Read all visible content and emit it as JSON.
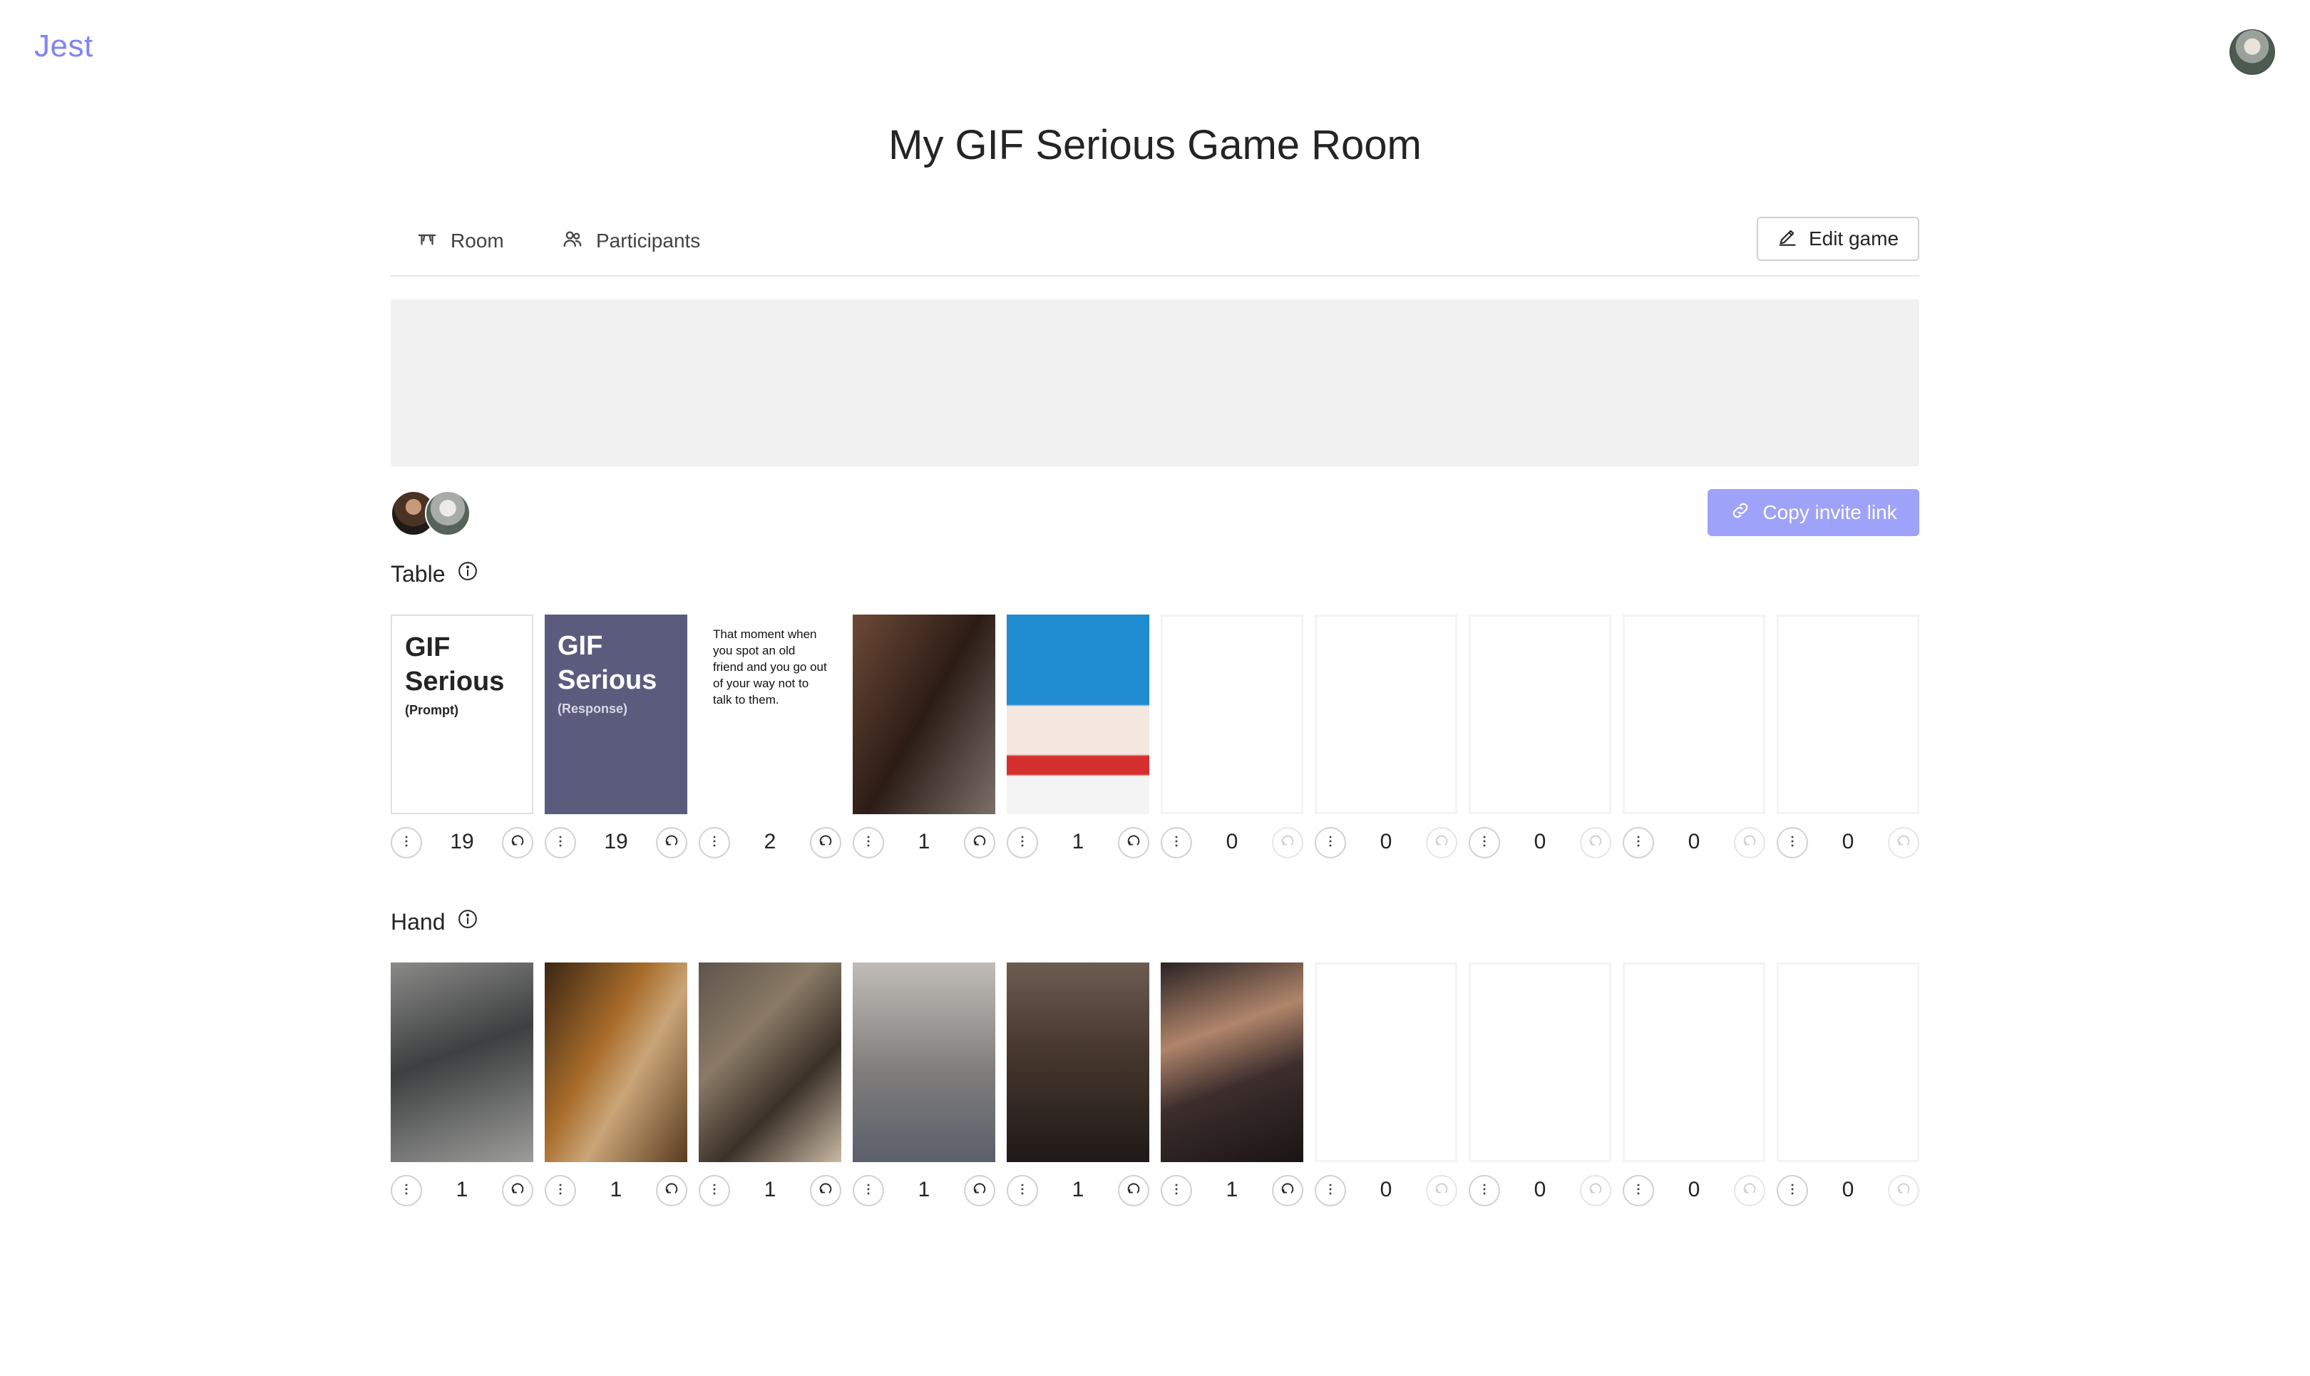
{
  "app": {
    "brand": "Jest"
  },
  "page": {
    "title": "My GIF Serious Game Room"
  },
  "tabs": [
    {
      "label": "Room",
      "icon": "table-icon"
    },
    {
      "label": "Participants",
      "icon": "people-icon"
    }
  ],
  "toolbar": {
    "edit_label": "Edit game",
    "copy_invite_label": "Copy invite link"
  },
  "colors": {
    "brand": "#7f85f5",
    "accent_button": "#9ea2f8",
    "response_card": "#5b5b7e",
    "banner": "#f1f1f1"
  },
  "sections": {
    "table_label": "Table",
    "hand_label": "Hand"
  },
  "table": [
    {
      "kind": "prompt",
      "line1": "GIF",
      "line2": "Serious",
      "sub": "(Prompt)",
      "count": "19"
    },
    {
      "kind": "response",
      "line1": "GIF",
      "line2": "Serious",
      "sub": "(Response)",
      "count": "19"
    },
    {
      "kind": "text",
      "text": "That moment when you spot an old friend and you go out of your way not to talk to them.",
      "count": "2"
    },
    {
      "kind": "gif",
      "count": "1"
    },
    {
      "kind": "gif",
      "count": "1"
    },
    {
      "kind": "empty",
      "count": "0"
    },
    {
      "kind": "empty",
      "count": "0"
    },
    {
      "kind": "empty",
      "count": "0"
    },
    {
      "kind": "empty",
      "count": "0"
    },
    {
      "kind": "empty",
      "count": "0"
    }
  ],
  "hand": [
    {
      "kind": "gif",
      "count": "1"
    },
    {
      "kind": "gif",
      "count": "1"
    },
    {
      "kind": "gif",
      "count": "1"
    },
    {
      "kind": "gif",
      "count": "1"
    },
    {
      "kind": "gif",
      "count": "1"
    },
    {
      "kind": "gif",
      "count": "1"
    },
    {
      "kind": "empty",
      "count": "0"
    },
    {
      "kind": "empty",
      "count": "0"
    },
    {
      "kind": "empty",
      "count": "0"
    },
    {
      "kind": "empty",
      "count": "0"
    }
  ]
}
